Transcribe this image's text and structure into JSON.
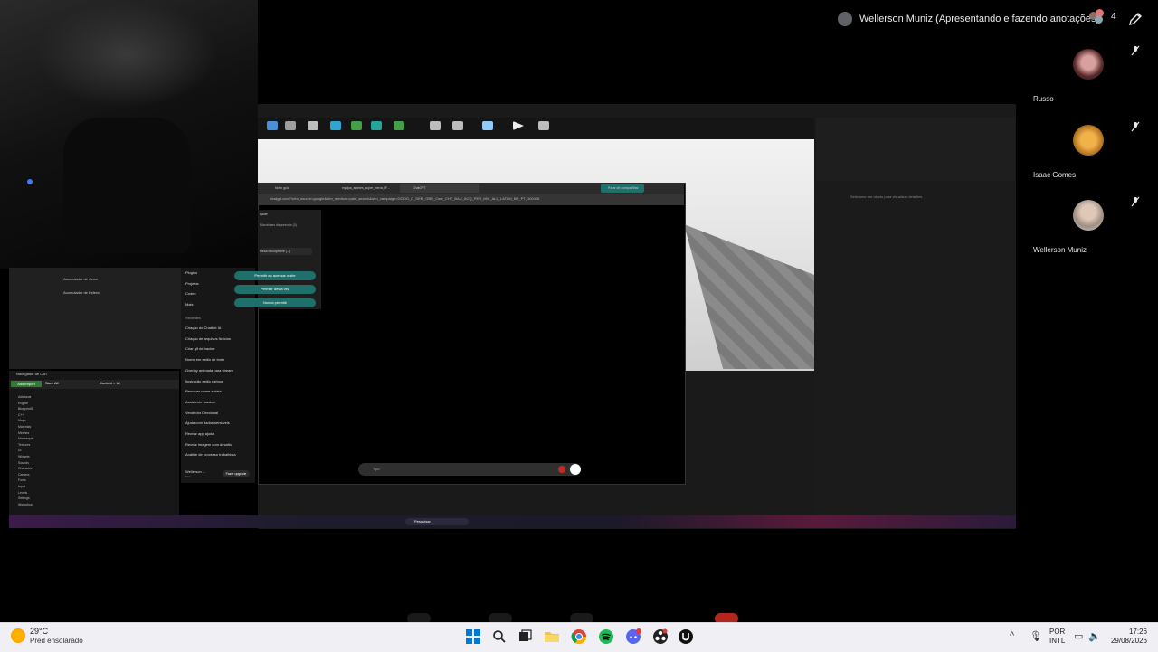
{
  "meet": {
    "presenter_label": "Wellerson Muniz (Apresentando e fazendo anotações)",
    "participant_count": "4",
    "participants": [
      {
        "name": "Russo"
      },
      {
        "name": "Isaac Gomes"
      },
      {
        "name": "Wellerson Muniz"
      }
    ]
  },
  "shared_screen": {
    "browser_tabs": [
      "Novo guia",
      "equipa_animes_super_heros_IF...",
      "ChatGPT"
    ],
    "share_button": "Parar de compartilhar",
    "url": "chatgpt.com/?utm_source=google&utm_medium=paid_search&utm_campaign=GOOG_C_SEM_GBR_Core_CHT_BAU_ACQ_PER_MIX_ALL_LATAM_BR_PT_100426",
    "mic_panel_title": "Quer",
    "mic_devices_label": "Microfones disponíveis (3)",
    "mic_selected": "Mesa Microphone (...)",
    "permission_buttons": [
      "Permitir ao acessar o site",
      "Permitir desta vez",
      "Nunca permitir"
    ],
    "prompt_placeholder": "Tipo",
    "sidebar": {
      "items": [
        "Plugins",
        "Projetos",
        "Codex",
        "Mais"
      ],
      "recents_label": "Recentes",
      "recents": [
        "Criação do Chatbot IA",
        "Criação de arquivos fictícios",
        "Criar gif de hacker",
        "Nome em estilo de fonte",
        "Overlay animada para stream",
        "Ilustração estilo cartoon",
        "Remover nome e data",
        "Assistente useável",
        "Vendedor Direcional",
        "Ajuda com dados sensíveis",
        "Recriar app ajuda",
        "Recriar imagem com desafio",
        "Análise de processo trabalhista"
      ],
      "user_name": "Wellerson ...",
      "user_plan": "Free",
      "upgrade_label": "Fazer upgrade"
    },
    "ue_left_items": [
      "Acumulador de Cena",
      "Acumulador de Esfera"
    ],
    "content_browser": {
      "title": "Navegador de Con",
      "add_import": "Add/Import",
      "save_all": "Save All",
      "breadcrumb": "Content > UI",
      "tree": [
        "Adicionar",
        "Engine",
        "BlueprintS",
        "C++",
        "Maps",
        "Materials",
        "Meshes",
        "Mannequin",
        "Textures",
        "UI",
        "Widgets",
        "Sounds",
        "Characters",
        "Camera",
        "Fonts",
        "Input",
        "Levels",
        "Settings",
        "Workshop"
      ]
    },
    "details_hint": "Selecione um objeto para visualizar detalhes",
    "inner_search": "Pesquisar"
  },
  "taskbar": {
    "weather_temp": "29°C",
    "weather_desc": "Pred ensolarado",
    "language_line1": "POR",
    "language_line2": "INTL",
    "time": "17:26",
    "date": "29/08/2026"
  }
}
